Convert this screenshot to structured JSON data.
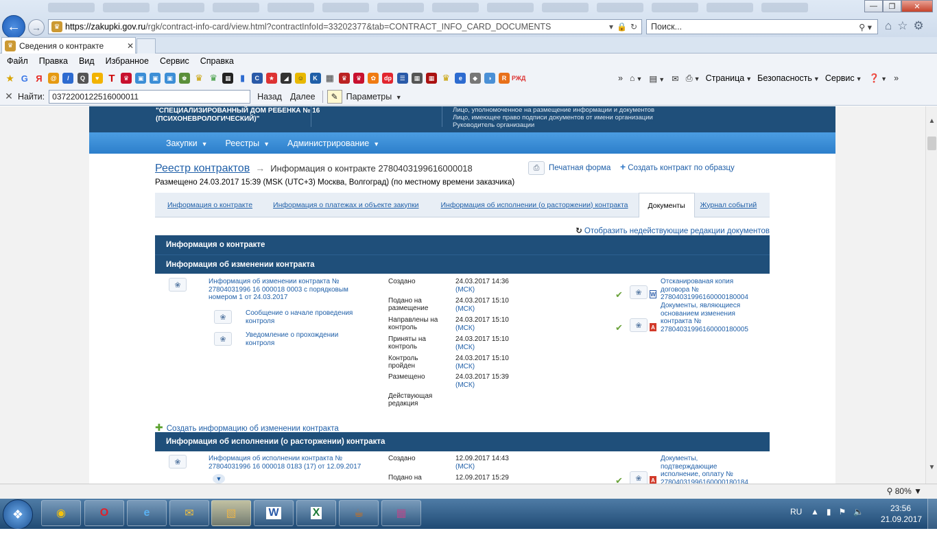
{
  "browser": {
    "url_host": "https://zakupki.gov.ru",
    "url_path": "/rgk/contract-info-card/view.html?contractInfoId=33202377&tab=CONTRACT_INFO_CARD_DOCUMENTS",
    "search_placeholder": "Поиск...",
    "tab_title": "Сведения о контракте",
    "menu": [
      "Файл",
      "Правка",
      "Вид",
      "Избранное",
      "Сервис",
      "Справка"
    ],
    "commands": {
      "page": "Страница",
      "security": "Безопасность",
      "tools": "Сервис"
    },
    "find": {
      "label": "Найти:",
      "value": "0372200122516000011",
      "prev": "Назад",
      "next": "Далее",
      "options": "Параметры"
    },
    "zoom": "80%"
  },
  "page": {
    "org_name_line1": "\"СПЕЦИАЛИЗИРОВАННЫЙ ДОМ РЕБЕНКА № 16",
    "org_name_line2": "(ПСИХОНЕВРОЛОГИЧЕСКИЙ)\"",
    "roles": [
      "Лицо, уполномоченное на размещение информации и документов",
      "Лицо, имеющее право подписи документов от имени организации",
      "Руководитель организации"
    ],
    "nav": [
      "Закупки",
      "Реестры",
      "Администрирование"
    ],
    "breadcrumb_link": "Реестр контрактов",
    "breadcrumb_current": "Информация о контракте 2780403199616000018",
    "posted": "Размещено 24.03.2017 15:39 (MSK (UTC+3) Москва, Волгоград) (по местному времени заказчика)",
    "print_form": "Печатная форма",
    "create_by_sample": "Создать контракт по образцу",
    "tabs": [
      "Информация о контракте",
      "Информация о платежах и объекте закупки",
      "Информация об исполнении (о расторжении) контракта",
      "Документы",
      "Журнал событий"
    ],
    "show_inactive": "Отобразить недействующие редакции документов",
    "sections": {
      "contract_info": "Информация о контракте",
      "change_info": "Информация об изменении контракта",
      "execution_info": "Информация об исполнении (о расторжении) контракта"
    },
    "change_doc": {
      "title_l1": "Информация об изменении контракта №",
      "title_l2": "27804031996 16 000018 0003 с порядковым",
      "title_l3": "номером 1 от 24.03.2017",
      "sub1_l1": "Сообщение о начале проведения",
      "sub1_l2": "контроля",
      "sub2_l1": "Уведомление о прохождении",
      "sub2_l2": "контроля"
    },
    "statuses": [
      {
        "l1": "Создано",
        "l2": "",
        "date": "24.03.2017 14:36",
        "tz": "(МСК)"
      },
      {
        "l1": "Подано на",
        "l2": "размещение",
        "date": "24.03.2017 15:10",
        "tz": "(МСК)"
      },
      {
        "l1": "Направлены на",
        "l2": "контроль",
        "date": "24.03.2017 15:10",
        "tz": "(МСК)"
      },
      {
        "l1": "Приняты на",
        "l2": "контроль",
        "date": "24.03.2017 15:10",
        "tz": "(МСК)"
      },
      {
        "l1": "Контроль",
        "l2": "пройден",
        "date": "24.03.2017 15:10",
        "tz": "(МСК)"
      },
      {
        "l1": "Размещено",
        "l2": "",
        "date": "24.03.2017 15:39",
        "tz": "(МСК)"
      },
      {
        "l1": "Действующая",
        "l2": "редакция",
        "date": "",
        "tz": ""
      }
    ],
    "attachments": {
      "a1_l1": "Отсканированая копия",
      "a1_l2": "договора №",
      "a1_l3": "27804031996160000180004",
      "a2_l1": "Документы, являющиеся",
      "a2_l2": "основанием изменения",
      "a2_l3": "контракта №",
      "a2_l4": "27804031996160000180005"
    },
    "create_change": "Создать информацию об изменении контракта",
    "exec_doc": {
      "title_l1": "Информация об исполнении контракта №",
      "title_l2": "27804031996 16 000018 0183 (17) от 12.09.2017",
      "status1_label": "Создано",
      "status1_date": "12.09.2017 14:43",
      "status1_tz": "(МСК)",
      "status2_label": "Подано на",
      "status2_date": "12.09.2017 15:29",
      "attach_l1": "Документы,",
      "attach_l2": "подтверждающие",
      "attach_l3": "исполнение, оплату №",
      "attach_l4": "27804031996160000180184"
    }
  },
  "taskbar": {
    "lang": "RU",
    "time": "23:56",
    "date": "21.09.2017"
  },
  "colors": {
    "header_dark": "#1f4f7a",
    "nav_blue": "#2d7fcb",
    "link": "#1f5fa8"
  }
}
